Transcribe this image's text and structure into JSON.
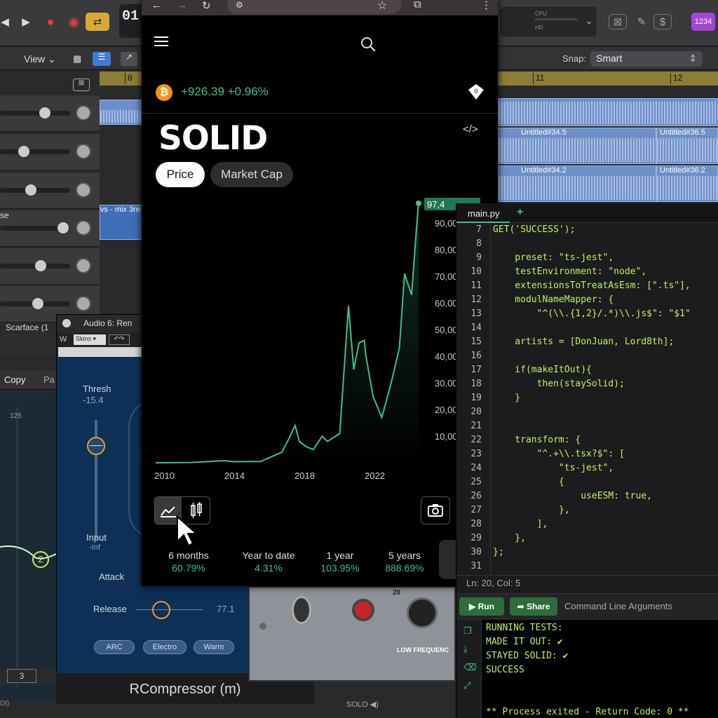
{
  "daw": {
    "lcd": "01",
    "cpu_labels": [
      "CPU",
      "HD"
    ],
    "menu_view": "View",
    "snap_label": "Snap:",
    "snap_value": "Smart",
    "lcd_count": "1234",
    "ruler_marks": [
      "8",
      "11",
      "12"
    ],
    "track_label_se": "se",
    "track_label_scarface": "Scarface (1",
    "region_mix": "vs - mix 3re",
    "regions": [
      "Untitled#34.5",
      "Untitled#36.5",
      "Untitled#34.2",
      "Untitled#36.2"
    ],
    "copy_label": "Copy",
    "pa_label": "Pa",
    "eq_125": "125",
    "eq_node": "2",
    "eq_3": "3",
    "bottom_left": "Dt)",
    "solo": "SOLO"
  },
  "plugin": {
    "title": "Audio 6: Ren",
    "skins": "Skins",
    "thresh_label": "Thresh",
    "thresh_value": "-15.4",
    "input_label": "Input",
    "input_value": "-Inf",
    "attack_label": "Attack",
    "release_label": "Release",
    "release_value": "77.1",
    "modes": [
      "ARC",
      "Electro",
      "Warm"
    ],
    "name": "RCompressor (m)"
  },
  "hardware": {
    "label": "LOW FREQUENC",
    "dial_value": "20"
  },
  "browser": {
    "price_change": "+926.39 +0.96%",
    "title": "SOLID",
    "tabs": [
      "Price",
      "Market Cap"
    ],
    "current_price_badge": "97,4",
    "performance": [
      {
        "label": "6 months",
        "value": "60.79%"
      },
      {
        "label": "Year to date",
        "value": "4.31%"
      },
      {
        "label": "1 year",
        "value": "103.95%"
      },
      {
        "label": "5 years",
        "value": "888.69%"
      }
    ]
  },
  "chart_data": {
    "type": "line",
    "title": "",
    "xlabel": "",
    "ylabel": "",
    "x_ticks": [
      "2010",
      "2014",
      "2018",
      "2022"
    ],
    "y_ticks": [
      "10,00",
      "20,00",
      "30,00",
      "40,00",
      "50,00",
      "60,00",
      "70,00",
      "80,00",
      "90,00"
    ],
    "xlim": [
      2010,
      2025
    ],
    "ylim": [
      0,
      97400
    ],
    "series": [
      {
        "x": [
          2010,
          2012,
          2013.9,
          2014.5,
          2016,
          2017.2,
          2017.6,
          2017.95,
          2018.2,
          2018.6,
          2019.0,
          2019.5,
          2019.8,
          2020.5,
          2021.0,
          2021.3,
          2021.6,
          2021.9,
          2022.0,
          2022.4,
          2022.9,
          2023.4,
          2023.9,
          2024.2,
          2024.6,
          2024.9,
          2025.0
        ],
        "y": [
          0,
          100,
          800,
          400,
          500,
          4000,
          9000,
          14000,
          8000,
          6000,
          5000,
          10000,
          8000,
          11000,
          59000,
          35000,
          45000,
          46000,
          40000,
          25000,
          17000,
          29000,
          43000,
          71000,
          63000,
          90000,
          97400
        ]
      }
    ],
    "grid": false,
    "legend": "none",
    "line_color": "#3fbf8e"
  },
  "editor": {
    "filename": "main.py",
    "add": "+",
    "status": "Ln: 20, Col: 5",
    "run": "Run",
    "share": "Share",
    "cmd_args": "Command Line Arguments",
    "lines": [
      {
        "n": "7",
        "t": "GET('SUCCESS');"
      },
      {
        "n": "8",
        "t": ""
      },
      {
        "n": "9",
        "t": "    preset: \"ts-jest\","
      },
      {
        "n": "10",
        "t": "    testEnvironment: \"node\","
      },
      {
        "n": "11",
        "t": "    extensionsToTreatAsEsm: [\".ts\"],"
      },
      {
        "n": "12",
        "t": "    modulNameMapper: {"
      },
      {
        "n": "13",
        "t": "        \"^(\\\\.{1,2}/.*)\\\\.js$\": \"$1\""
      },
      {
        "n": "14",
        "t": ""
      },
      {
        "n": "15",
        "t": "    artists = [DonJuan, Lord8th];"
      },
      {
        "n": "16",
        "t": ""
      },
      {
        "n": "17",
        "t": "    if(makeItOut){"
      },
      {
        "n": "18",
        "t": "        then(staySolid);"
      },
      {
        "n": "19",
        "t": "    }"
      },
      {
        "n": "20",
        "t": ""
      },
      {
        "n": "21",
        "t": ""
      },
      {
        "n": "22",
        "t": "    transform: {"
      },
      {
        "n": "23",
        "t": "        \"^.+\\\\.tsx?$\": ["
      },
      {
        "n": "24",
        "t": "            \"ts-jest\","
      },
      {
        "n": "25",
        "t": "            {"
      },
      {
        "n": "26",
        "t": "                useESM: true,"
      },
      {
        "n": "27",
        "t": "            },"
      },
      {
        "n": "28",
        "t": "        ],"
      },
      {
        "n": "29",
        "t": "    },"
      },
      {
        "n": "30",
        "t": "};"
      },
      {
        "n": "31",
        "t": ""
      }
    ],
    "console": [
      "RUNNING TESTS:",
      "MADE IT OUT: ✔",
      "STAYED SOLID: ✔",
      "SUCCESS",
      "",
      "",
      "** Process exited - Return Code: 0 **"
    ]
  }
}
